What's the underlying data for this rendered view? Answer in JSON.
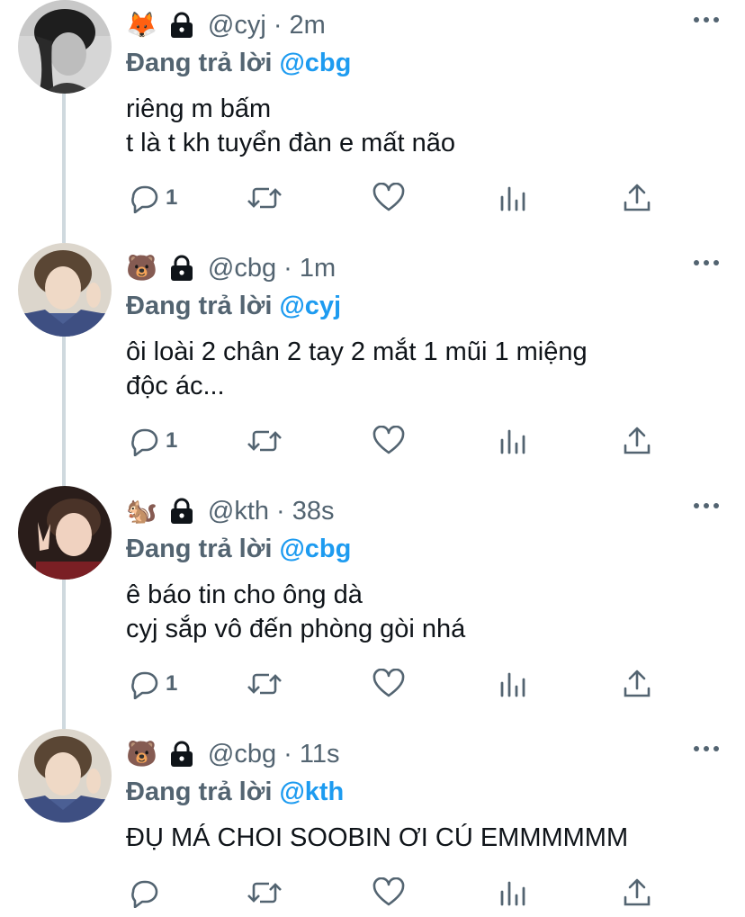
{
  "colors": {
    "accent": "#1d9bf0",
    "secondary_text": "#536471",
    "primary_text": "#0f1419",
    "thread_line": "#cfd9de"
  },
  "tweets": [
    {
      "emoji": "🦊",
      "lock_icon": "lock-icon",
      "meta": "@cyj · 2m",
      "reply_prefix": "Đang trả lời",
      "reply_handle": "@cbg",
      "text": "riêng m bấm\nt là t kh tuyển đàn e mất não",
      "reply_count": "1",
      "avatar": "avatar-photo"
    },
    {
      "emoji": "🐻",
      "lock_icon": "lock-icon",
      "meta": "@cbg · 1m",
      "reply_prefix": "Đang trả lời",
      "reply_handle": "@cyj",
      "text": "ôi loài 2 chân 2 tay 2 mắt 1 mũi 1 miệng\nđộc ác...",
      "reply_count": "1",
      "avatar": "avatar-photo"
    },
    {
      "emoji": "🐿️",
      "lock_icon": "lock-icon",
      "meta": "@kth · 38s",
      "reply_prefix": "Đang trả lời",
      "reply_handle": "@cbg",
      "text": "ê báo tin cho ông dà\ncyj sắp vô đến phòng gòi nhá",
      "reply_count": "1",
      "avatar": "avatar-photo"
    },
    {
      "emoji": "🐻",
      "lock_icon": "lock-icon",
      "meta": "@cbg · 11s",
      "reply_prefix": "Đang trả lời",
      "reply_handle": "@kth",
      "text": "ĐỤ MÁ CHOI SOOBIN ƠI CÚ EMMMMMM",
      "reply_count": "",
      "avatar": "avatar-photo"
    }
  ]
}
